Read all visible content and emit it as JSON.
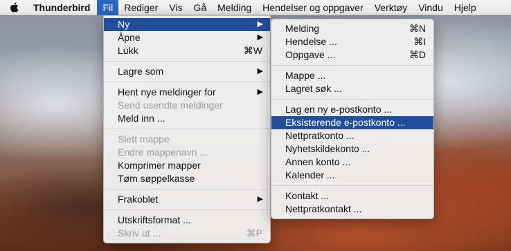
{
  "menubar": {
    "apple_icon": "apple-logo-icon",
    "app_name": "Thunderbird",
    "items": [
      "Fil",
      "Rediger",
      "Vis",
      "Gå",
      "Melding",
      "Hendelser og oppgaver",
      "Verktøy",
      "Vindu",
      "Hjelp"
    ]
  },
  "file_menu": {
    "ny": "Ny",
    "apne": "Åpne",
    "lukk": "Lukk",
    "lukk_shortcut": "⌘W",
    "lagre_som": "Lagre som",
    "hent": "Hent nye meldinger for",
    "send_usendte": "Send usendte meldinger",
    "meld_inn": "Meld inn ...",
    "slett_mappe": "Slett mappe",
    "endre_mappenavn": "Endre mappenavn ...",
    "komprimer": "Komprimer mapper",
    "tom": "Tøm søppelkasse",
    "frakoblet": "Frakoblet",
    "utskriftsformat": "Utskriftsformat ...",
    "skriv_ut": "Skriv ut ...",
    "skriv_ut_shortcut": "⌘P"
  },
  "new_submenu": {
    "melding": "Melding",
    "melding_shortcut": "⌘N",
    "hendelse": "Hendelse ...",
    "hendelse_shortcut": "⌘I",
    "oppgave": "Oppgave ...",
    "oppgave_shortcut": "⌘D",
    "mappe": "Mappe ...",
    "lagret_sok": "Lagret søk ...",
    "lag_ny": "Lag en ny e-postkonto ...",
    "eksisterende": "Eksisterende e-postkonto ...",
    "nettpratkonto": "Nettpratkonto ...",
    "nyhetskilde": "Nyhetskildekonto ...",
    "annen": "Annen konto ...",
    "kalender": "Kalender ...",
    "kontakt": "Kontakt ...",
    "nettpratkontakt": "Nettpratkontakt ..."
  },
  "arrow_glyph": "▶",
  "colors": {
    "highlight": "#234e99",
    "menubar_active": "#2a64c4",
    "disabled_text": "#9a9a9a"
  }
}
